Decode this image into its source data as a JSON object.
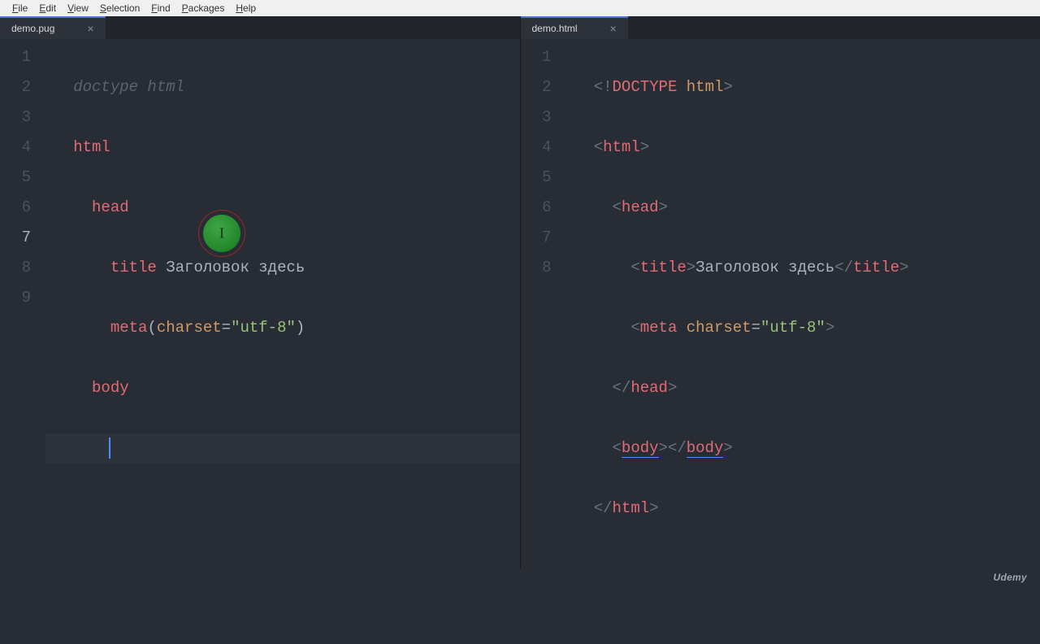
{
  "menu": {
    "file": "File",
    "edit": "Edit",
    "view": "View",
    "selection": "Selection",
    "find": "Find",
    "packages": "Packages",
    "help": "Help"
  },
  "tabs": {
    "left": {
      "title": "demo.pug"
    },
    "right": {
      "title": "demo.html"
    }
  },
  "left_pane": {
    "line_numbers": [
      "1",
      "2",
      "3",
      "4",
      "5",
      "6",
      "7",
      "8",
      "9"
    ],
    "current_line": 7,
    "lines": {
      "l1_comment": "doctype html",
      "l2_tag": "html",
      "l3_tag": "head",
      "l4_tag": "title",
      "l4_text": " Заголовок здесь",
      "l5_tag": "meta",
      "l5_p_open": "(",
      "l5_attr": "charset",
      "l5_eq": "=",
      "l5_str": "\"utf-8\"",
      "l5_p_close": ")",
      "l6_tag": "body"
    }
  },
  "right_pane": {
    "line_numbers": [
      "1",
      "2",
      "3",
      "4",
      "5",
      "6",
      "7",
      "8"
    ],
    "lines": {
      "l1_a1": "<!",
      "l1_kw": "DOCTYPE",
      "l1_sp": " ",
      "l1_at": "html",
      "l1_a2": ">",
      "l2_a1": "<",
      "l2_tag": "html",
      "l2_a2": ">",
      "l3_a1": "<",
      "l3_tag": "head",
      "l3_a2": ">",
      "l4_a1": "<",
      "l4_tag1": "title",
      "l4_a2": ">",
      "l4_text": "Заголовок здесь",
      "l4_a3": "</",
      "l4_tag2": "title",
      "l4_a4": ">",
      "l5_a1": "<",
      "l5_tag": "meta",
      "l5_sp": " ",
      "l5_attr": "charset",
      "l5_eq": "=",
      "l5_str": "\"utf-8\"",
      "l5_a2": ">",
      "l6_a1": "</",
      "l6_tag": "head",
      "l6_a2": ">",
      "l7_a1": "<",
      "l7_tag1": "body",
      "l7_a2": ">",
      "l7_a3": "</",
      "l7_tag2": "body",
      "l7_a4": ">",
      "l8_a1": "</",
      "l8_tag": "html",
      "l8_a2": ">"
    }
  },
  "footer": {
    "brand": "Udemy"
  }
}
